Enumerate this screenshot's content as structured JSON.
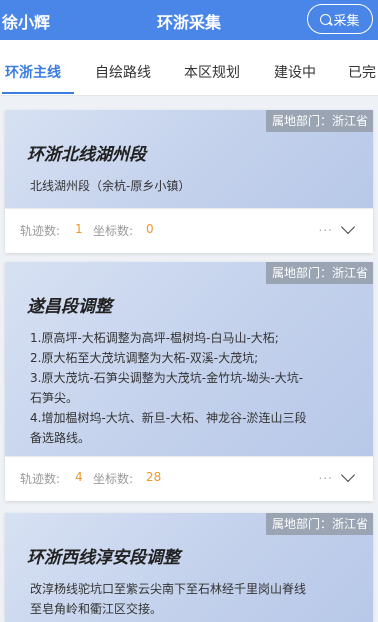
{
  "header": {
    "user": "徐小辉",
    "title": "环浙采集",
    "collect_label": "采集"
  },
  "tabs": [
    {
      "label": "环浙主线"
    },
    {
      "label": "自绘路线"
    },
    {
      "label": "本区规划"
    },
    {
      "label": "建设中"
    },
    {
      "label": "已完"
    }
  ],
  "cards": [
    {
      "dept": "属地部门：浙江省",
      "title": "环浙北线湖州段",
      "desc_lines": [
        "北线湖州段（余杭-原乡小镇）"
      ],
      "track_label": "轨迹数:",
      "track_count": "1",
      "coord_label": "坐标数:",
      "coord_count": "0",
      "more": "..."
    },
    {
      "dept": "属地部门：浙江省",
      "title": "遂昌段调整",
      "desc_lines": [
        "1.原高坪-大柘调整为高坪-榅树坞-白马山-大柘;",
        "2.原大柘至大茂坑调整为大柘-双溪-大茂坑;",
        "3.原大茂坑-石笋尖调整为大茂坑-金竹坑-坳头-大坑-",
        "石笋尖。",
        "4.增加榅树坞-大坑、新旦-大柘、神龙谷-淤连山三段",
        "备选路线。"
      ],
      "track_label": "轨迹数:",
      "track_count": "4",
      "coord_label": "坐标数:",
      "coord_count": "28",
      "more": "..."
    },
    {
      "dept": "属地部门：浙江省",
      "title": "环浙西线淳安段调整",
      "desc_lines": [
        "改淳杨线驼坑口至紫云尖南下至石林经千里岗山脊线",
        "至皂角岭和衢江区交接。"
      ]
    }
  ]
}
